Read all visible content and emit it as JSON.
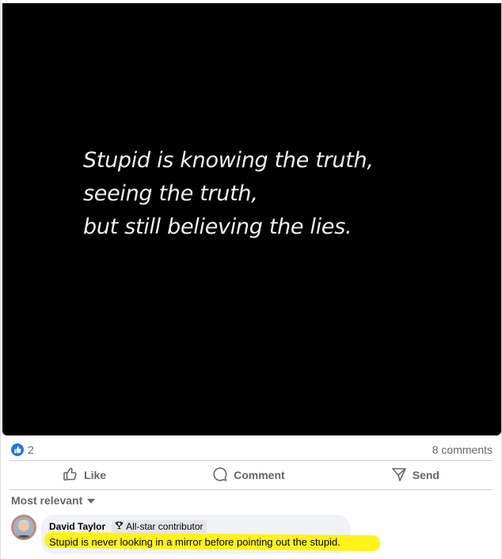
{
  "post": {
    "quote_lines": [
      "Stupid is knowing the truth,",
      "seeing the truth,",
      "but still believing the lies."
    ]
  },
  "stats": {
    "reaction_count": "2",
    "comments_count": "8 comments"
  },
  "actions": {
    "like_label": "Like",
    "comment_label": "Comment",
    "send_label": "Send"
  },
  "comments_section": {
    "sort_label": "Most relevant",
    "comments": [
      {
        "author": "David Taylor",
        "badge": "All-star contributor",
        "text": "Stupid is never looking in a mirror before pointing out the stupid.",
        "highlight_color": "#fff200"
      }
    ]
  },
  "colors": {
    "accent": "#1877f2",
    "muted_text": "#65676b",
    "bubble_bg": "#f0f2f5"
  }
}
